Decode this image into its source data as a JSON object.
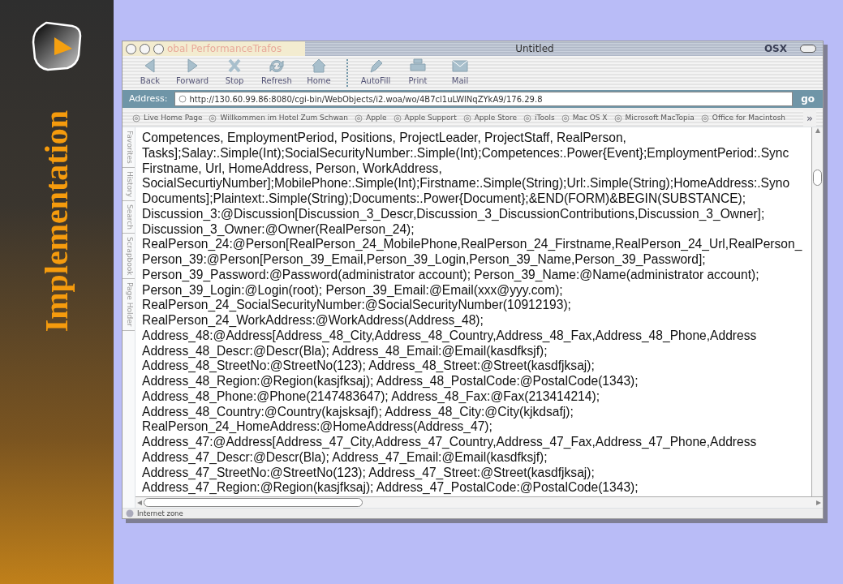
{
  "slide": {
    "title": "Implementation"
  },
  "browser": {
    "window": {
      "title": "Untitled",
      "background_tab": "obal PerformanceTrafos",
      "badge": "OSX"
    },
    "toolbar_groups": [
      {
        "items": [
          {
            "label": "Back",
            "kind": "back"
          },
          {
            "label": "Forward",
            "kind": "forward"
          },
          {
            "label": "Stop",
            "kind": "stop"
          },
          {
            "label": "Refresh",
            "kind": "refresh"
          },
          {
            "label": "Home",
            "kind": "home"
          }
        ]
      },
      {
        "items": [
          {
            "label": "AutoFill",
            "kind": "autofill"
          },
          {
            "label": "Print",
            "kind": "print"
          },
          {
            "label": "Mail",
            "kind": "mail"
          }
        ]
      }
    ],
    "address": {
      "label": "Address:",
      "value": "http://130.60.99.86:8080/cgi-bin/WebObjects/i2.woa/wo/4B7cl1uLWlNqZYkA9/176.29.8",
      "go": "go"
    },
    "favorites": [
      "Live Home Page",
      "Willkommen im Hotel Zum Schwan",
      "Apple",
      "Apple Support",
      "Apple Store",
      "iTools",
      "Mac OS X",
      "Microsoft MacTopia",
      "Office for Macintosh"
    ],
    "favorites_more": "»",
    "side_tabs": [
      "Favorites",
      "History",
      "Search",
      "Scrapbook",
      "Page Holder"
    ],
    "content": {
      "lines": [
        "Competences, EmploymentPeriod, Positions, ProjectLeader, ProjectStaff, RealPerson,",
        "Tasks];Salay:.Simple(Int);SocialSecurityNumber:.Simple(Int);Competences:.Power{Event};EmploymentPeriod:.Sync",
        "Firstname, Url, HomeAddress, Person, WorkAddress,",
        "SocialSecurtiyNumber];MobilePhone:.Simple(Int);Firstname:.Simple(String);Url:.Simple(String);HomeAddress:.Syno",
        "Documents];Plaintext:.Simple(String);Documents:.Power{Document};&END(FORM)&BEGIN(SUBSTANCE);",
        "Discussion_3:@Discussion[Discussion_3_Descr,Discussion_3_DiscussionContributions,Discussion_3_Owner];",
        "Discussion_3_Owner:@Owner(RealPerson_24);",
        "RealPerson_24:@Person[RealPerson_24_MobilePhone,RealPerson_24_Firstname,RealPerson_24_Url,RealPerson_",
        "Person_39:@Person[Person_39_Email,Person_39_Login,Person_39_Name,Person_39_Password];",
        "Person_39_Password:@Password(administrator account); Person_39_Name:@Name(administrator account);",
        "Person_39_Login:@Login(root); Person_39_Email:@Email(xxx@yyy.com);",
        "RealPerson_24_SocialSecurityNumber:@SocialSecurityNumber(10912193);",
        "RealPerson_24_WorkAddress:@WorkAddress(Address_48);",
        "Address_48:@Address[Address_48_City,Address_48_Country,Address_48_Fax,Address_48_Phone,Address",
        "Address_48_Descr:@Descr(Bla); Address_48_Email:@Email(kasdfksjf);",
        "Address_48_StreetNo:@StreetNo(123); Address_48_Street:@Street(kasdfjksaj);",
        "Address_48_Region:@Region(kasjfksaj); Address_48_PostalCode:@PostalCode(1343);",
        "Address_48_Phone:@Phone(2147483647); Address_48_Fax:@Fax(213414214);",
        "Address_48_Country:@Country(kajsksajf); Address_48_City:@City(kjkdsafj);",
        "RealPerson_24_HomeAddress:@HomeAddress(Address_47);",
        "Address_47:@Address[Address_47_City,Address_47_Country,Address_47_Fax,Address_47_Phone,Address",
        "Address_47_Descr:@Descr(Bla); Address_47_Email:@Email(kasdfksjf);",
        "Address_47_StreetNo:@StreetNo(123); Address_47_Street:@Street(kasdfjksaj);",
        "Address_47_Region:@Region(kasjfksaj); Address_47_PostalCode:@PostalCode(1343);"
      ]
    },
    "status_bar": "Internet zone"
  }
}
